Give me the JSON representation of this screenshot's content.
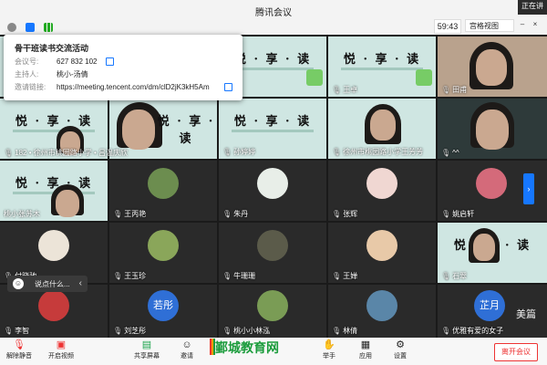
{
  "window": {
    "title": "腾讯会议",
    "recording_badge": "正在讲"
  },
  "statusbar": {
    "timer": "59:43",
    "view_button": "宫格视图"
  },
  "meeting_info": {
    "title": "骨干班读书交流活动",
    "meeting_id_label": "会议号:",
    "meeting_id": "627 832 102",
    "host_label": "主持人:",
    "host": "桃小-汤倩",
    "invite_label": "邀请链接:",
    "invite_link": "https://meeting.tencent.com/dm/clD2jK3kH5Am"
  },
  "slide": {
    "title": "悦·享·读",
    "title_spaced": "悦 · 享 · 读"
  },
  "participants": {
    "r1c3": "",
    "r1c4": "王卓",
    "r1c5": "田甫",
    "r2c1": "182 • 徐州市桃园路小学 • 吕温庆欣",
    "r2c3": "孙婷婷",
    "r2c4": "徐州市桃园路小学王芳芳",
    "r2c5": "^^",
    "r3c1": "桃小张苏木",
    "r3c2": "王丙艳",
    "r3c3": "朱丹",
    "r3c4": "张辉",
    "r3c5": "姚启轩",
    "r4c1": "付晓驰",
    "r4c2": "王玉珍",
    "r4c3": "牛珊珊",
    "r4c4": "王婵",
    "r4c5": "石翠",
    "r5c1": "李智",
    "r5c2": "刘芝彤",
    "r5c3": "桃小小林泓",
    "r5c4": "林倩",
    "r5c5": "优雅有爱的女子"
  },
  "avatar_text": {
    "r5c2": "若彤",
    "r5c5": "芷月"
  },
  "chat": {
    "placeholder": "说点什么..."
  },
  "toolbar": {
    "mute": "解除静音",
    "video": "开启视频",
    "share": "共享屏幕",
    "invite": "邀请",
    "members": "管理成员",
    "chat": "聊天",
    "apps": "应用",
    "settings": "设置",
    "reactions": "举手",
    "record": "录制",
    "leave": "离开会议"
  },
  "watermark": {
    "site": "鄞城教育网",
    "meipian": "美篇"
  },
  "colors": {
    "accent": "#1677ff",
    "leave": "#e33333",
    "slide_bg": "#cfe6e2"
  }
}
